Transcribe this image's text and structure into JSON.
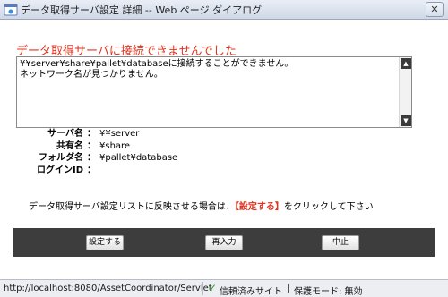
{
  "window": {
    "title": "データ取得サーバ設定 詳細 -- Web ページ ダイアログ",
    "close_glyph": "✕",
    "icon": "ie-window-icon"
  },
  "error": {
    "heading": "データ取得サーバに接続できませんでした",
    "message": "¥¥server¥share¥pallet¥databaseに接続することができません。\nネットワーク名が見つかりません。"
  },
  "scrollbar": {
    "up_glyph": "▲",
    "down_glyph": "▼"
  },
  "info": {
    "server_label": "サーバ名",
    "server_value": "¥¥server",
    "share_label": "共有名",
    "share_value": "¥share",
    "folder_label": "フォルダ名",
    "folder_value": "¥pallet¥database",
    "login_label": "ログインID",
    "login_value": "",
    "colon": "："
  },
  "notice": {
    "prefix": "データ取得サーバ設定リストに反映させる場合は、",
    "highlight": "【設定する】",
    "suffix": "をクリックして下さい"
  },
  "buttons": {
    "set": "設定する",
    "reenter": "再入力",
    "cancel": "中止"
  },
  "status": {
    "url": "http://localhost:8080/AssetCoordinator/Servlet",
    "trusted_check": "✓",
    "trusted": "信頼済みサイト",
    "pipe": "|",
    "protected_mode": "保護モード: 無効"
  },
  "colors": {
    "error_red": "#e2321e",
    "button_bar": "#3d3d3d",
    "trusted_green": "#2e9a2e"
  }
}
